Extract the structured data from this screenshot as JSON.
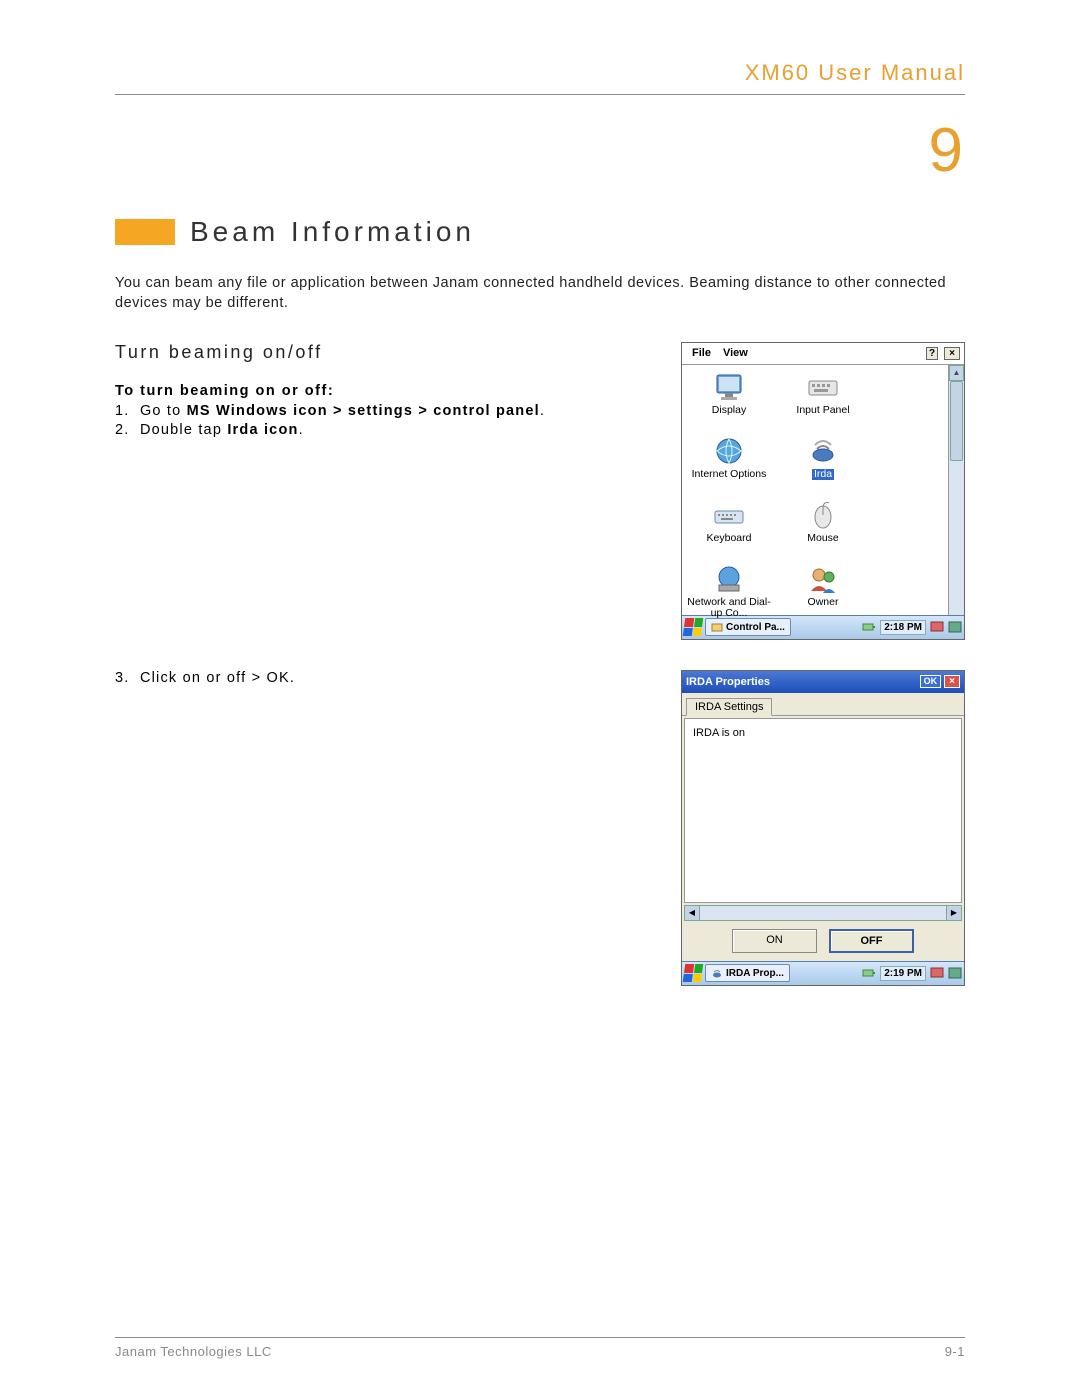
{
  "header": {
    "title": "XM60 User Manual"
  },
  "chapter_number": "9",
  "section_title": "Beam Information",
  "intro": "You can beam any file or application between Janam connected handheld devices. Beaming distance to other connected devices may be different.",
  "subheading": "Turn beaming on/off",
  "steps_intro": "To turn beaming on or off:",
  "step1_pre": "Go to ",
  "step1_em": "MS Windows icon > settings > control panel",
  "step1_post": ".",
  "step2_pre": "Double tap ",
  "step2_em": "Irda icon",
  "step2_post": ".",
  "step3_pre": "Click ",
  "step3_em1": "on",
  "step3_mid": " or ",
  "step3_em2": "off",
  "step3_mid2": " > ",
  "step3_em3": "OK",
  "step3_post": ".",
  "shot1": {
    "menu": {
      "file": "File",
      "view": "View"
    },
    "icons": {
      "display": "Display",
      "input_panel": "Input Panel",
      "internet_options": "Internet Options",
      "irda": "Irda",
      "keyboard": "Keyboard",
      "mouse": "Mouse",
      "network": "Network and Dial-up Co...",
      "owner": "Owner"
    },
    "task_label": "Control Pa...",
    "time": "2:18 PM"
  },
  "shot2": {
    "title": "IRDA Properties",
    "ok": "OK",
    "tab": "IRDA Settings",
    "status": "IRDA is on",
    "on": "ON",
    "off": "OFF",
    "task_label": "IRDA Prop...",
    "time": "2:19 PM"
  },
  "footer": {
    "company": "Janam Technologies LLC",
    "page": "9-1"
  }
}
